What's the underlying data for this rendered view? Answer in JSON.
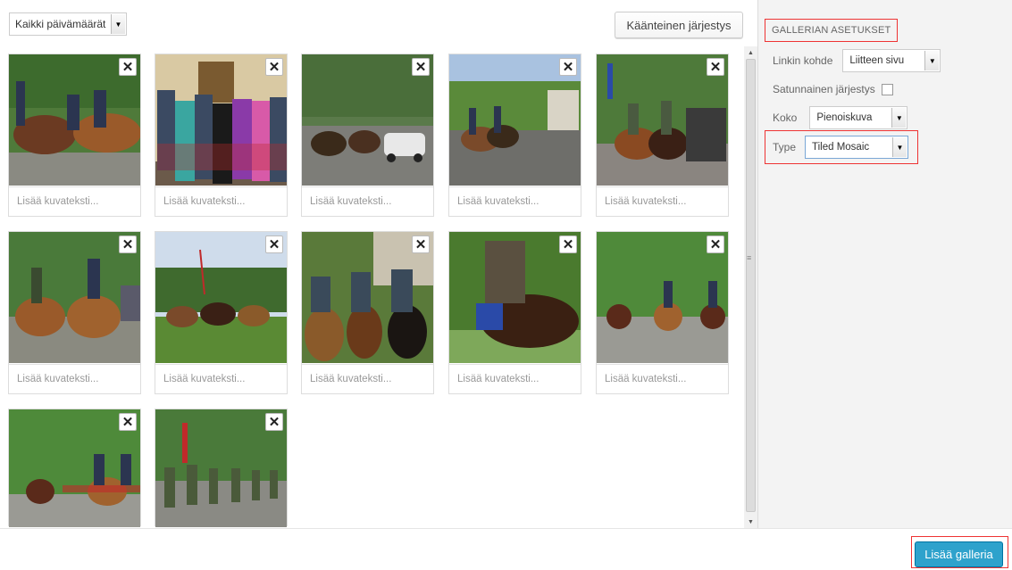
{
  "toolbar": {
    "date_filter": "Kaikki päivämäärät",
    "reverse_order_label": "Käänteinen järjestys"
  },
  "gallery": {
    "caption_placeholder": "Lisää kuvateksti...",
    "items_count_visible": 12
  },
  "settings": {
    "title": "GALLERIAN ASETUKSET",
    "link_to_label": "Linkin kohde",
    "link_to_value": "Liitteen sivu",
    "random_order_label": "Satunnainen järjestys",
    "random_order_checked": false,
    "size_label": "Koko",
    "size_value": "Pienoiskuva",
    "type_label": "Type",
    "type_value": "Tiled Mosaic"
  },
  "footer": {
    "add_gallery_label": "Lisää galleria"
  },
  "colors": {
    "primary_button": "#2ea2cc",
    "highlight_border": "#e33333"
  }
}
